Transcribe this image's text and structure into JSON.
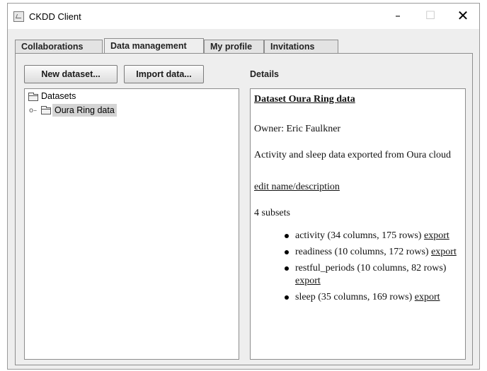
{
  "window": {
    "title": "CKDD Client",
    "controls": {
      "minimize": "–",
      "maximize": "☐",
      "close": "✕"
    }
  },
  "tabs": [
    {
      "label": "Collaborations"
    },
    {
      "label": "Data management"
    },
    {
      "label": "My profile"
    },
    {
      "label": "Invitations"
    }
  ],
  "toolbar": {
    "new_dataset": "New dataset...",
    "import_data": "Import data..."
  },
  "details_label": "Details",
  "tree": {
    "root": "Datasets",
    "items": [
      {
        "label": "Oura Ring data"
      }
    ]
  },
  "details": {
    "title": "Dataset Oura Ring data",
    "owner": "Owner: Eric Faulkner",
    "description": "Activity and sleep data exported from Oura cloud",
    "edit_link": "edit name/description",
    "subset_count": "4 subsets",
    "export_label": "export",
    "subsets": [
      {
        "text": "activity (34 columns, 175 rows)"
      },
      {
        "text": "readiness (10 columns, 172 rows)"
      },
      {
        "text": "restful_periods (10 columns, 82 rows)"
      },
      {
        "text": "sleep (35 columns, 169 rows)"
      }
    ]
  },
  "icons": {
    "app": "java-app-icon",
    "folder": "folder-icon",
    "tree_handle": "tree-expand-handle-icon"
  },
  "colors": {
    "window_bg": "#eeeeee",
    "selection": "#d4d4d4",
    "border": "#8d8d8d"
  }
}
